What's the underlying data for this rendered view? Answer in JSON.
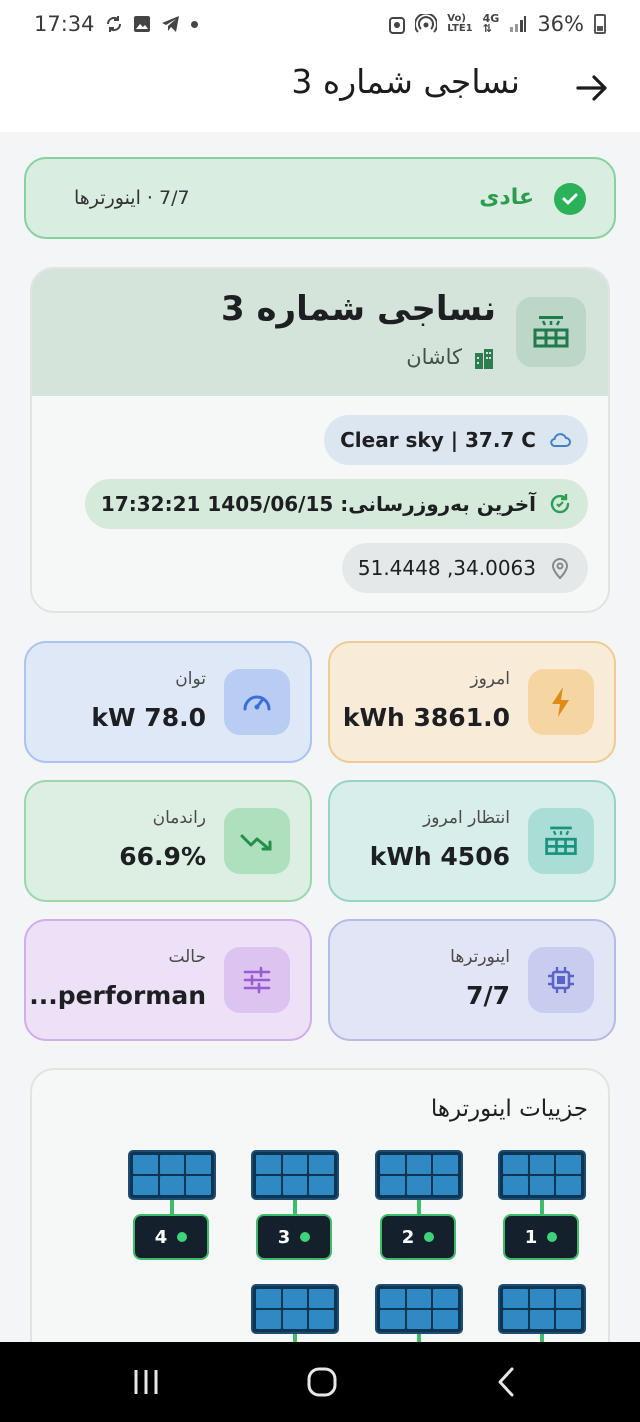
{
  "status_bar": {
    "time": "17:34",
    "battery": "36%",
    "left_icons": [
      "sync-icon",
      "image-icon",
      "telegram-icon",
      "dot-icon"
    ],
    "right_icons": [
      "alarm-icon",
      "hotspot-icon",
      "volte-icon",
      "4g-icon",
      "signal-icon",
      "battery-icon"
    ]
  },
  "app_bar": {
    "title": "نساجی شماره 3",
    "back_icon": "arrow-right-icon"
  },
  "status_card": {
    "label": "عادی",
    "inverters": "7/7 · اینورترها",
    "color": "#2bb15a"
  },
  "plant": {
    "name": "نساجی شماره 3",
    "city": "کاشان",
    "weather": "Clear sky | 37.7 C",
    "last_update": "آخرین به‌روزرسانی: 1405/06/15 17:32:21",
    "location": "51.4448 ,34.0063"
  },
  "kpis": {
    "power": {
      "label": "توان",
      "value": "kW 78.0",
      "icon": "gauge-icon"
    },
    "today": {
      "label": "امروز",
      "value": "kWh 3861.0",
      "icon": "lightning-icon"
    },
    "efficiency": {
      "label": "راندمان",
      "value": "66.9%",
      "icon": "trend-icon"
    },
    "expected": {
      "label": "انتظار امروز",
      "value": "kWh 4506",
      "icon": "solar-panel-icon"
    },
    "mode": {
      "label": "حالت",
      "value": "...performan",
      "icon": "sliders-icon"
    },
    "inverters": {
      "label": "اینورترها",
      "value": "7/7",
      "icon": "chip-icon"
    }
  },
  "inverter_details": {
    "title": "جزییات اینورترها",
    "row1": [
      "1",
      "2",
      "3",
      "4"
    ],
    "status_color": "#3ed27a"
  },
  "nav": {
    "buttons": [
      "recents-button",
      "home-button",
      "back-button"
    ]
  }
}
